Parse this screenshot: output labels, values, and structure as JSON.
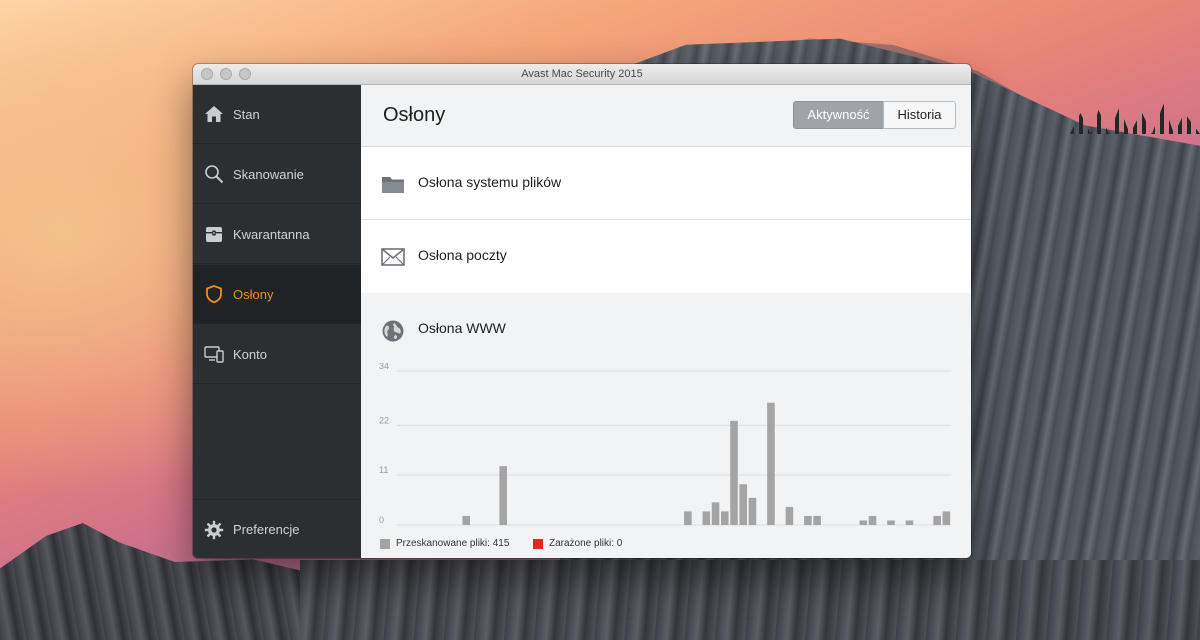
{
  "window": {
    "title": "Avast Mac Security 2015"
  },
  "sidebar": {
    "items": [
      {
        "label": "Stan",
        "icon": "home-icon"
      },
      {
        "label": "Skanowanie",
        "icon": "search-icon"
      },
      {
        "label": "Kwarantanna",
        "icon": "quarantine-chest-icon"
      },
      {
        "label": "Osłony",
        "icon": "shield-icon",
        "active": true
      },
      {
        "label": "Konto",
        "icon": "devices-icon"
      }
    ],
    "footer": {
      "label": "Preferencje",
      "icon": "gear-icon"
    }
  },
  "header": {
    "title": "Osłony",
    "tabs": [
      {
        "label": "Aktywność",
        "active": true
      },
      {
        "label": "Historia",
        "active": false
      }
    ]
  },
  "shields": [
    {
      "label": "Osłona systemu plików",
      "icon": "folder-icon"
    },
    {
      "label": "Osłona poczty",
      "icon": "envelope-icon"
    },
    {
      "label": "Osłona WWW",
      "icon": "globe-icon"
    }
  ],
  "colors": {
    "accent": "#f28c1c",
    "scanned": "#a4a4a4",
    "infected": "#e8261c"
  },
  "chart_data": {
    "type": "bar",
    "yticks": [
      "34",
      "22",
      "11",
      "0"
    ],
    "ylim": [
      0,
      34
    ],
    "grid": true,
    "values": [
      0,
      0,
      0,
      0,
      0,
      0,
      0,
      2,
      0,
      0,
      0,
      13,
      0,
      0,
      0,
      0,
      0,
      0,
      0,
      0,
      0,
      0,
      0,
      0,
      0,
      0,
      0,
      0,
      0,
      0,
      0,
      3,
      0,
      3,
      5,
      3,
      23,
      9,
      6,
      0,
      27,
      0,
      4,
      0,
      2,
      2,
      0,
      0,
      0,
      0,
      1,
      2,
      0,
      1,
      0,
      1,
      0,
      0,
      2,
      3
    ],
    "series": [
      {
        "name": "Przeskanowane pliki: 415",
        "color": "#a4a4a4"
      },
      {
        "name": "Zarażone pliki: 0",
        "color": "#e8261c"
      }
    ],
    "legend": "bottom-left"
  }
}
